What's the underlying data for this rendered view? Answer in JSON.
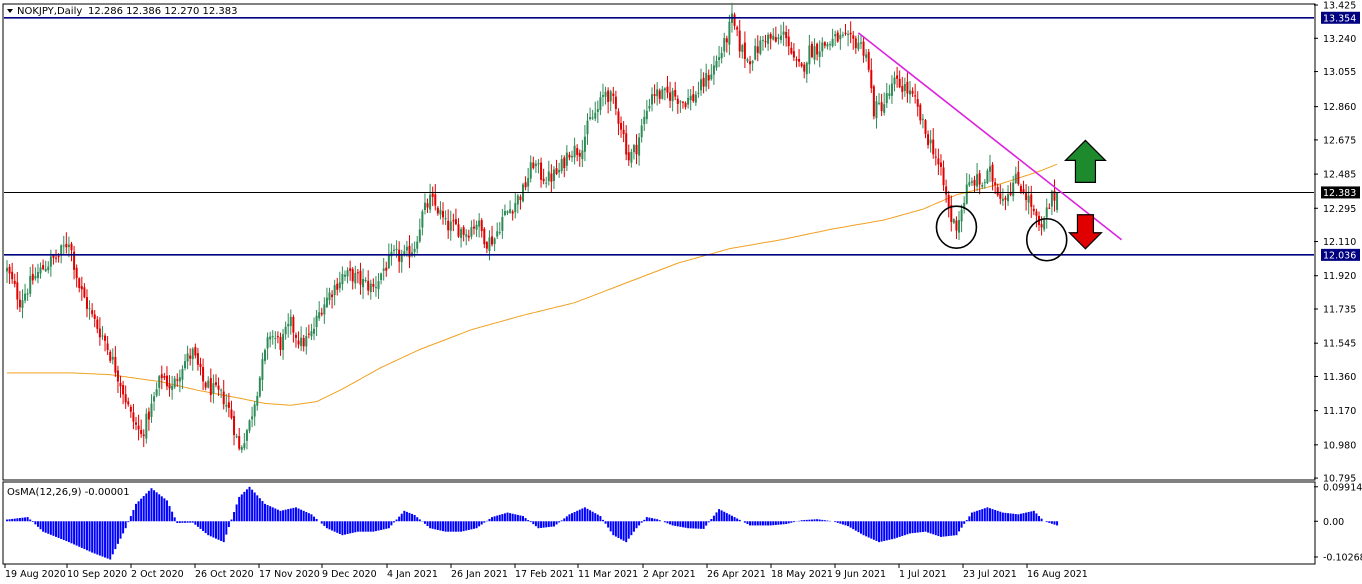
{
  "header": {
    "symbol_label": "NOKJPY,Daily",
    "ohlc_label": "12.286 12.386 12.270 12.383"
  },
  "indicator": {
    "label": "OsMA(12,26,9) -0.00001",
    "ticks": [
      "0.09914",
      "0.00",
      "-0.10268"
    ]
  },
  "colors": {
    "bull": "#2e8b57",
    "bear": "#e00000",
    "ma": "#f0a020",
    "trendline": "#dd22dd",
    "hline": "#000080",
    "current": "#000000",
    "osma": "#0000ff",
    "up_arrow": "#1e8a2e",
    "down_arrow": "#e00000"
  },
  "chart_data": {
    "type": "candlestick",
    "symbol": "NOKJPY",
    "timeframe": "Daily",
    "ylim": [
      10.79,
      13.425
    ],
    "y_ticks": [
      "13.425",
      "13.240",
      "13.055",
      "12.860",
      "12.675",
      "12.485",
      "12.295",
      "12.110",
      "11.920",
      "11.735",
      "11.545",
      "11.360",
      "11.170",
      "10.980",
      "10.795"
    ],
    "x_tick_labels": [
      "19 Aug 2020",
      "10 Sep 2020",
      "2 Oct 2020",
      "26 Oct 2020",
      "17 Nov 2020",
      "9 Dec 2020",
      "4 Jan 2021",
      "26 Jan 2021",
      "17 Feb 2021",
      "11 Mar 2021",
      "2 Apr 2021",
      "26 Apr 2021",
      "18 May 2021",
      "9 Jun 2021",
      "1 Jul 2021",
      "23 Jul 2021",
      "16 Aug 2021"
    ],
    "horizontal_lines": [
      {
        "value": 13.354,
        "label": "13.354",
        "kind": "resistance"
      },
      {
        "value": 12.383,
        "label": "12.383",
        "kind": "current"
      },
      {
        "value": 12.036,
        "label": "12.036",
        "kind": "support"
      }
    ],
    "close_path": [
      [
        0,
        11.95
      ],
      [
        5,
        11.78
      ],
      [
        10,
        11.9
      ],
      [
        15,
        11.98
      ],
      [
        20,
        12.03
      ],
      [
        24,
        12.12
      ],
      [
        28,
        11.86
      ],
      [
        33,
        11.69
      ],
      [
        38,
        11.56
      ],
      [
        44,
        11.33
      ],
      [
        48,
        11.14
      ],
      [
        52,
        11.03
      ],
      [
        56,
        11.19
      ],
      [
        60,
        11.37
      ],
      [
        64,
        11.29
      ],
      [
        68,
        11.43
      ],
      [
        72,
        11.49
      ],
      [
        76,
        11.33
      ],
      [
        80,
        11.28
      ],
      [
        84,
        11.24
      ],
      [
        87,
        11.14
      ],
      [
        90,
        10.95
      ],
      [
        94,
        11.1
      ],
      [
        98,
        11.36
      ],
      [
        102,
        11.6
      ],
      [
        106,
        11.54
      ],
      [
        110,
        11.65
      ],
      [
        114,
        11.54
      ],
      [
        118,
        11.59
      ],
      [
        122,
        11.75
      ],
      [
        126,
        11.84
      ],
      [
        130,
        11.92
      ],
      [
        134,
        11.92
      ],
      [
        138,
        11.88
      ],
      [
        142,
        11.85
      ],
      [
        146,
        11.96
      ],
      [
        150,
        12.03
      ],
      [
        154,
        12.02
      ],
      [
        158,
        12.09
      ],
      [
        161,
        12.26
      ],
      [
        164,
        12.34
      ],
      [
        167,
        12.29
      ],
      [
        170,
        12.2
      ],
      [
        174,
        12.19
      ],
      [
        178,
        12.16
      ],
      [
        182,
        12.22
      ],
      [
        186,
        12.11
      ],
      [
        189,
        12.13
      ],
      [
        192,
        12.24
      ],
      [
        196,
        12.31
      ],
      [
        200,
        12.39
      ],
      [
        204,
        12.55
      ],
      [
        207,
        12.48
      ],
      [
        210,
        12.46
      ],
      [
        214,
        12.5
      ],
      [
        218,
        12.62
      ],
      [
        222,
        12.62
      ],
      [
        226,
        12.78
      ],
      [
        229,
        12.84
      ],
      [
        232,
        12.95
      ],
      [
        235,
        12.88
      ],
      [
        238,
        12.76
      ],
      [
        241,
        12.57
      ],
      [
        244,
        12.64
      ],
      [
        247,
        12.79
      ],
      [
        250,
        12.94
      ],
      [
        254,
        12.92
      ],
      [
        258,
        12.93
      ],
      [
        262,
        12.89
      ],
      [
        266,
        12.91
      ],
      [
        270,
        12.99
      ],
      [
        274,
        13.08
      ],
      [
        278,
        13.2
      ],
      [
        281,
        13.34
      ],
      [
        284,
        13.2
      ],
      [
        287,
        13.12
      ],
      [
        290,
        13.16
      ],
      [
        294,
        13.25
      ],
      [
        298,
        13.22
      ],
      [
        302,
        13.27
      ],
      [
        305,
        13.1
      ],
      [
        308,
        13.06
      ],
      [
        311,
        13.17
      ],
      [
        314,
        13.19
      ],
      [
        318,
        13.21
      ],
      [
        322,
        13.24
      ],
      [
        326,
        13.22
      ],
      [
        330,
        13.22
      ],
      [
        333,
        13.16
      ],
      [
        336,
        12.84
      ],
      [
        340,
        12.88
      ],
      [
        344,
        12.99
      ],
      [
        348,
        12.97
      ],
      [
        352,
        12.88
      ],
      [
        356,
        12.71
      ],
      [
        359,
        12.63
      ],
      [
        362,
        12.48
      ],
      [
        364,
        12.36
      ],
      [
        366,
        12.23
      ],
      [
        368,
        12.2
      ],
      [
        370,
        12.29
      ],
      [
        372,
        12.4
      ],
      [
        375,
        12.45
      ],
      [
        378,
        12.43
      ],
      [
        381,
        12.49
      ],
      [
        384,
        12.4
      ],
      [
        386,
        12.36
      ],
      [
        388,
        12.39
      ],
      [
        391,
        12.45
      ],
      [
        394,
        12.4
      ],
      [
        397,
        12.31
      ],
      [
        399,
        12.22
      ],
      [
        401,
        12.16
      ],
      [
        403,
        12.27
      ],
      [
        405,
        12.35
      ],
      [
        407,
        12.383
      ]
    ],
    "moving_average": [
      [
        0,
        11.38
      ],
      [
        25,
        11.38
      ],
      [
        40,
        11.37
      ],
      [
        60,
        11.33
      ],
      [
        75,
        11.28
      ],
      [
        90,
        11.24
      ],
      [
        100,
        11.21
      ],
      [
        110,
        11.2
      ],
      [
        120,
        11.22
      ],
      [
        130,
        11.29
      ],
      [
        145,
        11.41
      ],
      [
        160,
        11.51
      ],
      [
        180,
        11.62
      ],
      [
        200,
        11.7
      ],
      [
        220,
        11.77
      ],
      [
        240,
        11.88
      ],
      [
        260,
        11.99
      ],
      [
        280,
        12.07
      ],
      [
        300,
        12.12
      ],
      [
        320,
        12.18
      ],
      [
        340,
        12.23
      ],
      [
        355,
        12.29
      ],
      [
        368,
        12.37
      ],
      [
        385,
        12.43
      ],
      [
        400,
        12.5
      ],
      [
        407,
        12.54
      ]
    ],
    "trendline": {
      "x": [
        330,
        432
      ],
      "y": [
        13.27,
        12.12
      ]
    },
    "osma_histogram": [
      [
        0,
        0.005
      ],
      [
        8,
        0.012
      ],
      [
        14,
        -0.03
      ],
      [
        24,
        -0.06
      ],
      [
        33,
        -0.09
      ],
      [
        40,
        -0.11
      ],
      [
        46,
        -0.02
      ],
      [
        50,
        0.05
      ],
      [
        56,
        0.095
      ],
      [
        62,
        0.06
      ],
      [
        66,
        -0.005
      ],
      [
        72,
        -0.004
      ],
      [
        78,
        -0.04
      ],
      [
        84,
        -0.06
      ],
      [
        90,
        0.07
      ],
      [
        94,
        0.099
      ],
      [
        100,
        0.05
      ],
      [
        106,
        0.03
      ],
      [
        112,
        0.04
      ],
      [
        118,
        0.02
      ],
      [
        124,
        -0.02
      ],
      [
        130,
        -0.04
      ],
      [
        136,
        -0.03
      ],
      [
        142,
        -0.03
      ],
      [
        148,
        -0.02
      ],
      [
        154,
        0.03
      ],
      [
        158,
        0.018
      ],
      [
        164,
        -0.02
      ],
      [
        170,
        -0.03
      ],
      [
        176,
        -0.03
      ],
      [
        182,
        -0.02
      ],
      [
        188,
        0.012
      ],
      [
        194,
        0.025
      ],
      [
        200,
        0.015
      ],
      [
        206,
        -0.02
      ],
      [
        212,
        -0.015
      ],
      [
        218,
        0.02
      ],
      [
        224,
        0.04
      ],
      [
        230,
        0.015
      ],
      [
        235,
        -0.04
      ],
      [
        240,
        -0.06
      ],
      [
        244,
        -0.02
      ],
      [
        248,
        0.012
      ],
      [
        252,
        0.006
      ],
      [
        258,
        -0.012
      ],
      [
        264,
        -0.02
      ],
      [
        270,
        -0.022
      ],
      [
        276,
        0.035
      ],
      [
        282,
        0.012
      ],
      [
        288,
        -0.012
      ],
      [
        296,
        -0.012
      ],
      [
        302,
        -0.008
      ],
      [
        308,
        0.003
      ],
      [
        314,
        0.006
      ],
      [
        320,
        0.0
      ],
      [
        326,
        -0.014
      ],
      [
        332,
        -0.04
      ],
      [
        338,
        -0.06
      ],
      [
        344,
        -0.05
      ],
      [
        350,
        -0.035
      ],
      [
        356,
        -0.03
      ],
      [
        362,
        -0.045
      ],
      [
        368,
        -0.04
      ],
      [
        374,
        0.025
      ],
      [
        380,
        0.04
      ],
      [
        386,
        0.025
      ],
      [
        392,
        0.02
      ],
      [
        398,
        0.03
      ],
      [
        402,
        0.0
      ],
      [
        407,
        -0.012
      ]
    ],
    "annotations": [
      {
        "type": "circle",
        "x": 368,
        "y": 12.19
      },
      {
        "type": "circle",
        "x": 403,
        "y": 12.12
      },
      {
        "type": "arrow_up",
        "x": 418,
        "y": 12.55
      },
      {
        "type": "arrow_down",
        "x": 418,
        "y": 12.17
      }
    ]
  }
}
